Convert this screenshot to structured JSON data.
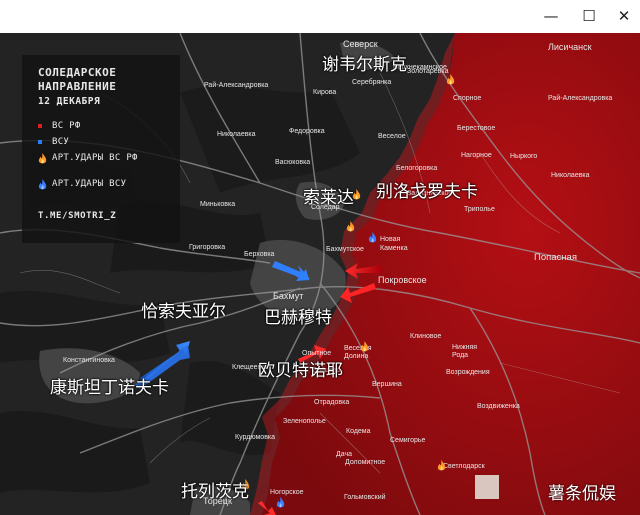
{
  "window": {
    "minimize_glyph": "—",
    "maximize_glyph": "☐",
    "close_glyph": "✕"
  },
  "legend": {
    "title_line1": "СОЛЕДАРСКОЕ",
    "title_line2": "НАПРАВЛЕНИЕ",
    "date": "12 ДЕКАБРЯ",
    "items": [
      {
        "label": "ВС РФ",
        "icon": "red-square-icon",
        "color": "#e02020"
      },
      {
        "label": "ВСУ",
        "icon": "blue-square-icon",
        "color": "#2a7fff"
      },
      {
        "label": "АРТ.УДАРЫ ВС РФ",
        "icon": "fire-icon",
        "color": "#ff9a2a"
      },
      {
        "label": "АРТ.УДАРЫ ВСУ",
        "icon": "blue-fire-icon",
        "color": "#3a7fff"
      }
    ],
    "link": "T.ME/SMOTRI_Z"
  },
  "places": [
    {
      "id": "severgsk",
      "name": "Северск"
    },
    {
      "id": "lisichansk",
      "name": "Лисичанск"
    },
    {
      "id": "verhnekamenskoe",
      "name": "Верхнекамнское"
    },
    {
      "id": "serebryanka",
      "name": "Серебрянка"
    },
    {
      "id": "kirova",
      "name": "Кирова"
    },
    {
      "id": "zolotaryovka",
      "name": "Золотарёвка"
    },
    {
      "id": "raj_aleksandrovka_w",
      "name": "Рай-Александровка"
    },
    {
      "id": "spornoe",
      "name": "Спорное"
    },
    {
      "id": "raj_aleksandrovka_e",
      "name": "Рай-Александровка"
    },
    {
      "id": "nikolaevka",
      "name": "Николаевка"
    },
    {
      "id": "fedorovka",
      "name": "Федоровка"
    },
    {
      "id": "veseloe",
      "name": "Веселое"
    },
    {
      "id": "berestovoe",
      "name": "Берестовое"
    },
    {
      "id": "nyrkovo",
      "name": "Ныркого"
    },
    {
      "id": "vasyukovka",
      "name": "Васюковка"
    },
    {
      "id": "nagornoe",
      "name": "Нагорное"
    },
    {
      "id": "belogorovka",
      "name": "Белогоровка"
    },
    {
      "id": "mikolaevka",
      "name": "Николаевка"
    },
    {
      "id": "zaliznyanskoe",
      "name": "Зализнянское"
    },
    {
      "id": "minkovka",
      "name": "Миньковка"
    },
    {
      "id": "soledar",
      "name": "Соледар"
    },
    {
      "id": "tripolye",
      "name": "Триполье"
    },
    {
      "id": "grigorovka",
      "name": "Григоровка"
    },
    {
      "id": "bahmutskoe",
      "name": "Бахмутское"
    },
    {
      "id": "novaya_kamenka_1",
      "name": "Новая"
    },
    {
      "id": "novaya_kamenka_2",
      "name": "Каменка"
    },
    {
      "id": "berhovka",
      "name": "Берховка"
    },
    {
      "id": "popasnaya",
      "name": "Попасная"
    },
    {
      "id": "pokrovskoe",
      "name": "Покровское"
    },
    {
      "id": "bahmut",
      "name": "Бахмут"
    },
    {
      "id": "klinovoe",
      "name": "Клиновое"
    },
    {
      "id": "konstantinovka",
      "name": "Константиновка"
    },
    {
      "id": "opytnoe",
      "name": "Опытное"
    },
    {
      "id": "veselaya_dolina_1",
      "name": "Веселая"
    },
    {
      "id": "veselaya_dolina_2",
      "name": "Долина"
    },
    {
      "id": "nezhnyaya_ruda_1",
      "name": "Нижняя"
    },
    {
      "id": "nezhnyaya_ruda_2",
      "name": "Рода"
    },
    {
      "id": "kleschievka",
      "name": "Клещеевка"
    },
    {
      "id": "zaytsevo",
      "name": "Зайцево"
    },
    {
      "id": "vozrozhdeniya",
      "name": "Возрождения"
    },
    {
      "id": "vershina",
      "name": "Вершина"
    },
    {
      "id": "otradovka",
      "name": "Отрадовка"
    },
    {
      "id": "vozdvizhenka",
      "name": "Воздвиженка"
    },
    {
      "id": "zelenopolye",
      "name": "Зеленополье"
    },
    {
      "id": "kodema",
      "name": "Кодема"
    },
    {
      "id": "kurdyumovka",
      "name": "Курдюмовка"
    },
    {
      "id": "semigorye",
      "name": "Семигорье"
    },
    {
      "id": "dacha",
      "name": "Дача"
    },
    {
      "id": "dolomitnoe",
      "name": "Доломитное"
    },
    {
      "id": "novgorodskoe",
      "name": "Ногорское"
    },
    {
      "id": "svetlodarsk",
      "name": "Светлодарск"
    },
    {
      "id": "toretsk",
      "name": "Торецк"
    },
    {
      "id": "golmovskiy",
      "name": "Гольмовский"
    }
  ],
  "annotations": [
    {
      "id": "cn_seversk",
      "text": "谢韦尔斯克"
    },
    {
      "id": "cn_soledar",
      "text": "索莱达"
    },
    {
      "id": "cn_belogorovka",
      "text": "别洛戈罗夫卡"
    },
    {
      "id": "cn_chasov_yar",
      "text": "恰索夫亚尔"
    },
    {
      "id": "cn_bakhmut",
      "text": "巴赫穆特"
    },
    {
      "id": "cn_opytnoe",
      "text": "欧贝特诺耶"
    },
    {
      "id": "cn_konstantinovka",
      "text": "康斯坦丁诺夫卡"
    },
    {
      "id": "cn_toretsk",
      "text": "托列茨克"
    }
  ],
  "watermark": "薯条侃娱"
}
